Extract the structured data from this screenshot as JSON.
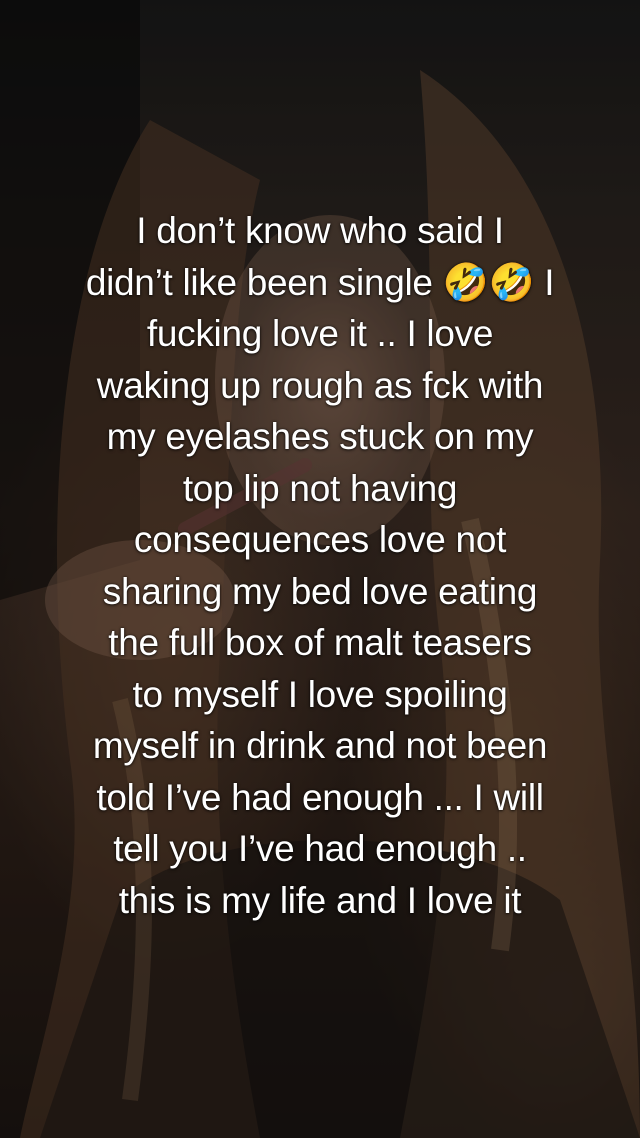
{
  "background": {
    "subject": "portrait-photo",
    "dominant_colors": [
      "#1b1b1b",
      "#3b2c24",
      "#6e5040",
      "#a07a60"
    ]
  },
  "caption": {
    "text": "I don’t know who said I\ndidn’t like been single 🤣🤣 I\nfucking love it .. I love\nwaking up rough as fck with\nmy eyelashes stuck on my\ntop lip not having\nconsequences love not\nsharing my bed love eating\nthe full box of malt teasers\nto myself I love spoiling\nmyself in drink and not been\ntold I’ve had enough ... I will\ntell you I’ve had enough ..\nthis is my life and I love it"
  }
}
